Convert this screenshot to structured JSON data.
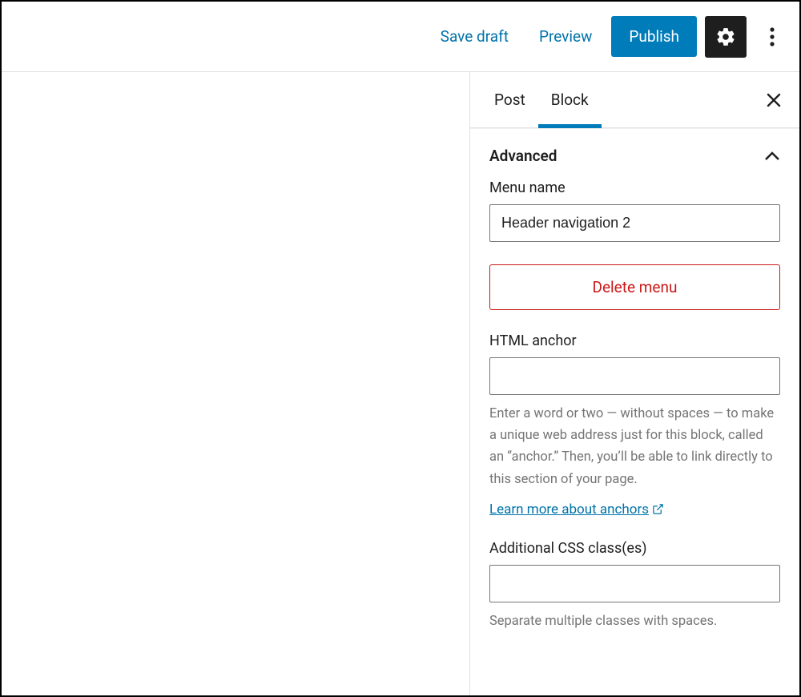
{
  "topbar": {
    "save_draft": "Save draft",
    "preview": "Preview",
    "publish": "Publish"
  },
  "sidebar": {
    "tabs": {
      "post": "Post",
      "block": "Block"
    },
    "advanced": {
      "title": "Advanced",
      "menu_name_label": "Menu name",
      "menu_name_value": "Header navigation 2",
      "delete_menu": "Delete menu",
      "html_anchor_label": "HTML anchor",
      "html_anchor_value": "",
      "anchor_help": "Enter a word or two — without spaces — to make a unique web address just for this block, called an “anchor.” Then, you’ll be able to link directly to this section of your page.",
      "learn_more": "Learn more about anchors",
      "css_label": "Additional CSS class(es)",
      "css_value": "",
      "css_help": "Separate multiple classes with spaces."
    }
  }
}
